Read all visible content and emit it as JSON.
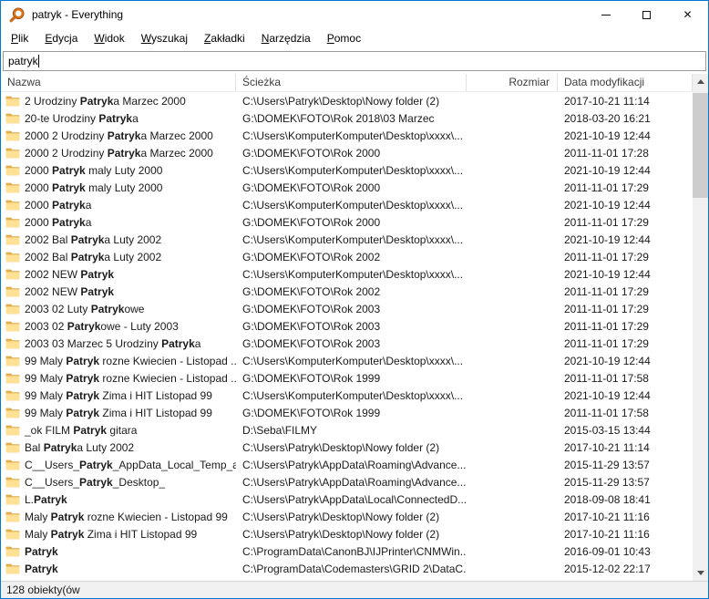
{
  "window": {
    "title": "patryk - Everything",
    "accent_color": "#0078d7"
  },
  "titlebar": {
    "controls": {
      "minimize": "minimize-bar",
      "maximize": "square-outline",
      "close_glyph": "✕"
    }
  },
  "icons": {
    "app_logo": "orange-magnifier",
    "folder": "yellow-folder",
    "scroll_up": "chevron-up",
    "scroll_down": "chevron-down"
  },
  "colors": {
    "accent": "#0078d7",
    "folder_front": "#ffe195",
    "folder_back": "#e3ac4d",
    "scroll_track": "#f0f0f0",
    "scroll_thumb": "#cdcdcd"
  },
  "menubar": {
    "items": [
      {
        "label": "Plik",
        "accel_index": 0
      },
      {
        "label": "Edycja",
        "accel_index": 0
      },
      {
        "label": "Widok",
        "accel_index": 0
      },
      {
        "label": "Wyszukaj",
        "accel_index": 0
      },
      {
        "label": "Zakładki",
        "accel_index": 0
      },
      {
        "label": "Narzędzia",
        "accel_index": 0
      },
      {
        "label": "Pomoc",
        "accel_index": 0
      }
    ]
  },
  "search": {
    "value": "patryk"
  },
  "table": {
    "columns": [
      {
        "label": "Nazwa"
      },
      {
        "label": "Ścieżka"
      },
      {
        "label": "Rozmiar"
      },
      {
        "label": "Data modyfikacji"
      }
    ],
    "rows": [
      {
        "name_pre": "2 Urodziny ",
        "name_match": "Patryk",
        "name_post": "a Marzec 2000",
        "path": "C:\\Users\\Patryk\\Desktop\\Nowy folder (2)",
        "size": "",
        "modified": "2017-10-21 11:14"
      },
      {
        "name_pre": "20-te Urodziny ",
        "name_match": "Patryk",
        "name_post": "a",
        "path": "G:\\DOMEK\\FOTO\\Rok 2018\\03 Marzec",
        "size": "",
        "modified": "2018-03-20 16:21"
      },
      {
        "name_pre": "2000 2 Urodziny ",
        "name_match": "Patryk",
        "name_post": "a Marzec 2000",
        "path": "C:\\Users\\KomputerKomputer\\Desktop\\xxxx\\...",
        "size": "",
        "modified": "2021-10-19 12:44"
      },
      {
        "name_pre": "2000 2 Urodziny ",
        "name_match": "Patryk",
        "name_post": "a Marzec 2000",
        "path": "G:\\DOMEK\\FOTO\\Rok 2000",
        "size": "",
        "modified": "2011-11-01 17:28"
      },
      {
        "name_pre": "2000 ",
        "name_match": "Patryk",
        "name_post": " maly Luty 2000",
        "path": "C:\\Users\\KomputerKomputer\\Desktop\\xxxx\\...",
        "size": "",
        "modified": "2021-10-19 12:44"
      },
      {
        "name_pre": "2000 ",
        "name_match": "Patryk",
        "name_post": " maly Luty 2000",
        "path": "G:\\DOMEK\\FOTO\\Rok 2000",
        "size": "",
        "modified": "2011-11-01 17:29"
      },
      {
        "name_pre": "2000 ",
        "name_match": "Patryk",
        "name_post": "a",
        "path": "C:\\Users\\KomputerKomputer\\Desktop\\xxxx\\...",
        "size": "",
        "modified": "2021-10-19 12:44"
      },
      {
        "name_pre": "2000 ",
        "name_match": "Patryk",
        "name_post": "a",
        "path": "G:\\DOMEK\\FOTO\\Rok 2000",
        "size": "",
        "modified": "2011-11-01 17:29"
      },
      {
        "name_pre": "2002 Bal ",
        "name_match": "Patryk",
        "name_post": "a Luty 2002",
        "path": "C:\\Users\\KomputerKomputer\\Desktop\\xxxx\\...",
        "size": "",
        "modified": "2021-10-19 12:44"
      },
      {
        "name_pre": "2002 Bal ",
        "name_match": "Patryk",
        "name_post": "a Luty 2002",
        "path": "G:\\DOMEK\\FOTO\\Rok 2002",
        "size": "",
        "modified": "2011-11-01 17:29"
      },
      {
        "name_pre": "2002 NEW ",
        "name_match": "Patryk",
        "name_post": "",
        "path": "C:\\Users\\KomputerKomputer\\Desktop\\xxxx\\...",
        "size": "",
        "modified": "2021-10-19 12:44"
      },
      {
        "name_pre": "2002 NEW ",
        "name_match": "Patryk",
        "name_post": "",
        "path": "G:\\DOMEK\\FOTO\\Rok 2002",
        "size": "",
        "modified": "2011-11-01 17:29"
      },
      {
        "name_pre": "2003 02 Luty ",
        "name_match": "Patryk",
        "name_post": "owe",
        "path": "G:\\DOMEK\\FOTO\\Rok 2003",
        "size": "",
        "modified": "2011-11-01 17:29"
      },
      {
        "name_pre": "2003 02 ",
        "name_match": "Patryk",
        "name_post": "owe - Luty 2003",
        "path": "G:\\DOMEK\\FOTO\\Rok 2003",
        "size": "",
        "modified": "2011-11-01 17:29"
      },
      {
        "name_pre": "2003 03 Marzec 5 Urodziny ",
        "name_match": "Patryk",
        "name_post": "a",
        "path": "G:\\DOMEK\\FOTO\\Rok 2003",
        "size": "",
        "modified": "2011-11-01 17:29"
      },
      {
        "name_pre": "99 Maly ",
        "name_match": "Patryk",
        "name_post": " rozne Kwiecien - Listopad ...",
        "path": "C:\\Users\\KomputerKomputer\\Desktop\\xxxx\\...",
        "size": "",
        "modified": "2021-10-19 12:44"
      },
      {
        "name_pre": "99 Maly ",
        "name_match": "Patryk",
        "name_post": " rozne Kwiecien - Listopad ...",
        "path": "G:\\DOMEK\\FOTO\\Rok 1999",
        "size": "",
        "modified": "2011-11-01 17:58"
      },
      {
        "name_pre": "99 Maly ",
        "name_match": "Patryk",
        "name_post": " Zima i HIT Listopad 99",
        "path": "C:\\Users\\KomputerKomputer\\Desktop\\xxxx\\...",
        "size": "",
        "modified": "2021-10-19 12:44"
      },
      {
        "name_pre": "99 Maly ",
        "name_match": "Patryk",
        "name_post": " Zima i HIT Listopad 99",
        "path": "G:\\DOMEK\\FOTO\\Rok 1999",
        "size": "",
        "modified": "2011-11-01 17:58"
      },
      {
        "name_pre": "_ok FILM ",
        "name_match": "Patryk",
        "name_post": " gitara",
        "path": "D:\\Seba\\FILMY",
        "size": "",
        "modified": "2015-03-15 13:44"
      },
      {
        "name_pre": "Bal ",
        "name_match": "Patryk",
        "name_post": "a Luty 2002",
        "path": "C:\\Users\\Patryk\\Desktop\\Nowy folder (2)",
        "size": "",
        "modified": "2017-10-21 11:14"
      },
      {
        "name_pre": "C__Users_",
        "name_match": "Patryk",
        "name_post": "_AppData_Local_Temp_ac...",
        "path": "C:\\Users\\Patryk\\AppData\\Roaming\\Advance...",
        "size": "",
        "modified": "2015-11-29 13:57"
      },
      {
        "name_pre": "C__Users_",
        "name_match": "Patryk",
        "name_post": "_Desktop_",
        "path": "C:\\Users\\Patryk\\AppData\\Roaming\\Advance...",
        "size": "",
        "modified": "2015-11-29 13:57"
      },
      {
        "name_pre": "L.",
        "name_match": "Patryk",
        "name_post": "",
        "path": "C:\\Users\\Patryk\\AppData\\Local\\ConnectedD...",
        "size": "",
        "modified": "2018-09-08 18:41"
      },
      {
        "name_pre": "Maly ",
        "name_match": "Patryk",
        "name_post": " rozne Kwiecien - Listopad 99",
        "path": "C:\\Users\\Patryk\\Desktop\\Nowy folder (2)",
        "size": "",
        "modified": "2017-10-21 11:16"
      },
      {
        "name_pre": "Maly ",
        "name_match": "Patryk",
        "name_post": " Zima i HIT Listopad 99",
        "path": "C:\\Users\\Patryk\\Desktop\\Nowy folder (2)",
        "size": "",
        "modified": "2017-10-21 11:16"
      },
      {
        "name_pre": "",
        "name_match": "Patryk",
        "name_post": "",
        "path": "C:\\ProgramData\\CanonBJ\\IJPrinter\\CNMWin...",
        "size": "",
        "modified": "2016-09-01 10:43"
      },
      {
        "name_pre": "",
        "name_match": "Patryk",
        "name_post": "",
        "path": "C:\\ProgramData\\Codemasters\\GRID 2\\DataC...",
        "size": "",
        "modified": "2015-12-02 22:17"
      }
    ]
  },
  "statusbar": {
    "text": "128 obiekty(ów"
  }
}
